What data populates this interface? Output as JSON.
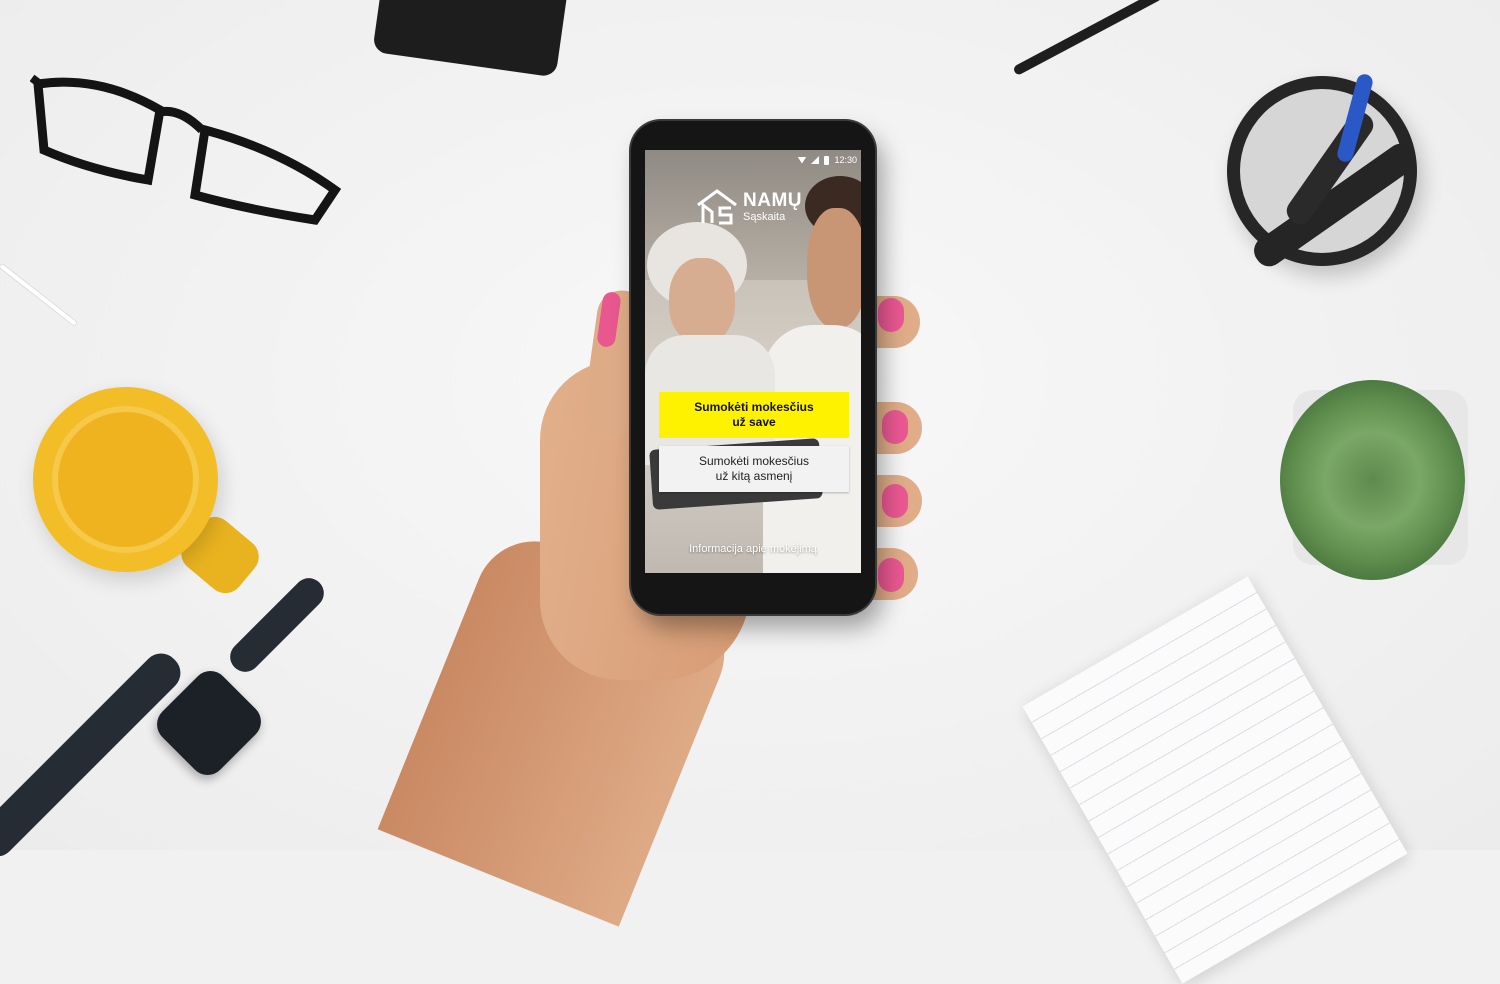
{
  "status_bar": {
    "time": "12:30"
  },
  "app": {
    "brand_name": "NAMŲ",
    "brand_subtitle": "Sąskaita",
    "accent_color": "#fff200"
  },
  "actions": {
    "primary_line1": "Sumokėti mokesčius",
    "primary_line2": "už save",
    "secondary_line1": "Sumokėti mokesčius",
    "secondary_line2": "už kitą asmenį"
  },
  "footer": {
    "info_link": "Informacija apie mokėjimą"
  }
}
